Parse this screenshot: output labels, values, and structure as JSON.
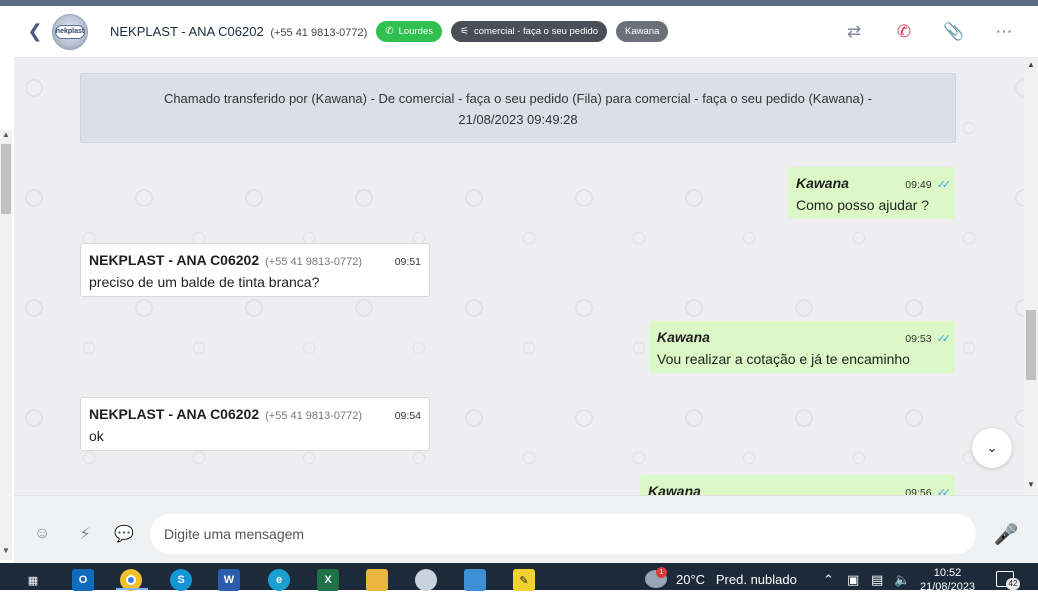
{
  "header": {
    "contact_name": "NEKPLAST - ANA C06202",
    "contact_phone": "(+55 41 9813-0772)",
    "avatar_text": "nekplast",
    "tags": [
      {
        "label": "Lourdes",
        "icon": "whatsapp-icon"
      },
      {
        "label": "comercial - faça o seu pedido",
        "icon": "sitemap-icon"
      },
      {
        "label": "Kawana"
      }
    ]
  },
  "notice": {
    "line1": "Chamado transferido por (Kawana) - De comercial - faça o seu pedido (Fila) para comercial - faça o seu pedido (Kawana) -",
    "line2": "21/08/2023 09:49:28"
  },
  "messages": [
    {
      "direction": "out",
      "sender": "Kawana",
      "time": "09:49",
      "text": "Como posso ajudar ?"
    },
    {
      "direction": "in",
      "sender": "NEKPLAST - ANA C06202",
      "phone": "(+55 41 9813-0772)",
      "time": "09:51",
      "text": "preciso de um balde de tinta branca?"
    },
    {
      "direction": "out",
      "sender": "Kawana",
      "time": "09:53",
      "text": "Vou realizar a cotação e já te encaminho"
    },
    {
      "direction": "in",
      "sender": "NEKPLAST - ANA C06202",
      "phone": "(+55 41 9813-0772)",
      "time": "09:54",
      "text": "ok"
    },
    {
      "direction": "out",
      "sender": "Kawana",
      "time": "09:56",
      "text": ""
    }
  ],
  "composer": {
    "placeholder": "Digite uma mensagem"
  },
  "taskbar": {
    "weather_temp": "20°C",
    "weather_desc": "Pred. nublado",
    "weather_badge": "1",
    "clock_time": "10:52",
    "clock_date": "21/08/2023",
    "notification_count": "42"
  },
  "colors": {
    "tag_green": "#2fc04f",
    "outgoing_bubble": "#dcf8c6",
    "read_check": "#3fa2f0",
    "end_call": "#d9344f"
  }
}
